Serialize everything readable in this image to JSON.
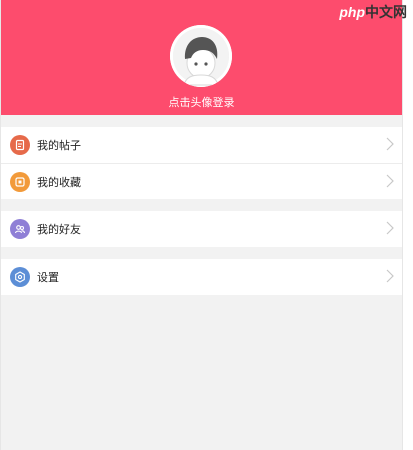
{
  "header": {
    "login_prompt": "点击头像登录",
    "bg_color": "#fd4c6d"
  },
  "watermark": {
    "php": "php",
    "cn": "中文网"
  },
  "menu": {
    "groups": [
      [
        {
          "label": "我的帖子",
          "icon": "post-icon",
          "color": "#e66a4a"
        },
        {
          "label": "我的收藏",
          "icon": "favorites-icon",
          "color": "#f29a3a"
        }
      ],
      [
        {
          "label": "我的好友",
          "icon": "friends-icon",
          "color": "#8f7fd6"
        }
      ],
      [
        {
          "label": "设置",
          "icon": "settings-icon",
          "color": "#5c8ed6"
        }
      ]
    ]
  }
}
